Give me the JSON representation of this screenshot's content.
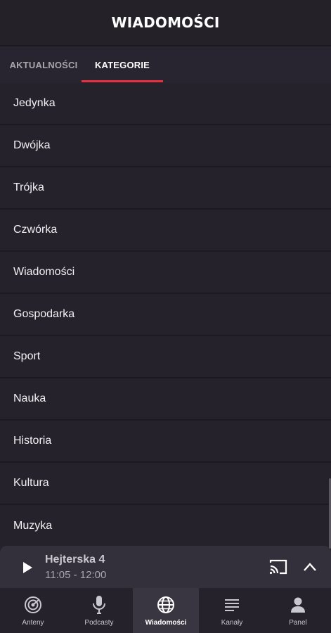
{
  "header": {
    "title": "WIADOMOŚCI"
  },
  "tabs": [
    {
      "label": "AKTUALNOŚCI",
      "active": false
    },
    {
      "label": "KATEGORIE",
      "active": true
    }
  ],
  "accent_color": "#e6323e",
  "categories": [
    "Jedynka",
    "Dwójka",
    "Trójka",
    "Czwórka",
    "Wiadomości",
    "Gospodarka",
    "Sport",
    "Nauka",
    "Historia",
    "Kultura",
    "Muzyka"
  ],
  "player": {
    "title": "Hejterska 4",
    "time": "11:05 - 12:00",
    "play_icon": "play-icon",
    "cast_icon": "cast-icon",
    "expand_icon": "chevron-up-icon"
  },
  "bottom_nav": [
    {
      "label": "Anteny",
      "icon": "radio-wave-icon",
      "active": false
    },
    {
      "label": "Podcasty",
      "icon": "microphone-icon",
      "active": false
    },
    {
      "label": "Wiadomości",
      "icon": "globe-icon",
      "active": true
    },
    {
      "label": "Kanały",
      "icon": "list-icon",
      "active": false
    },
    {
      "label": "Panel",
      "icon": "user-icon",
      "active": false
    }
  ]
}
